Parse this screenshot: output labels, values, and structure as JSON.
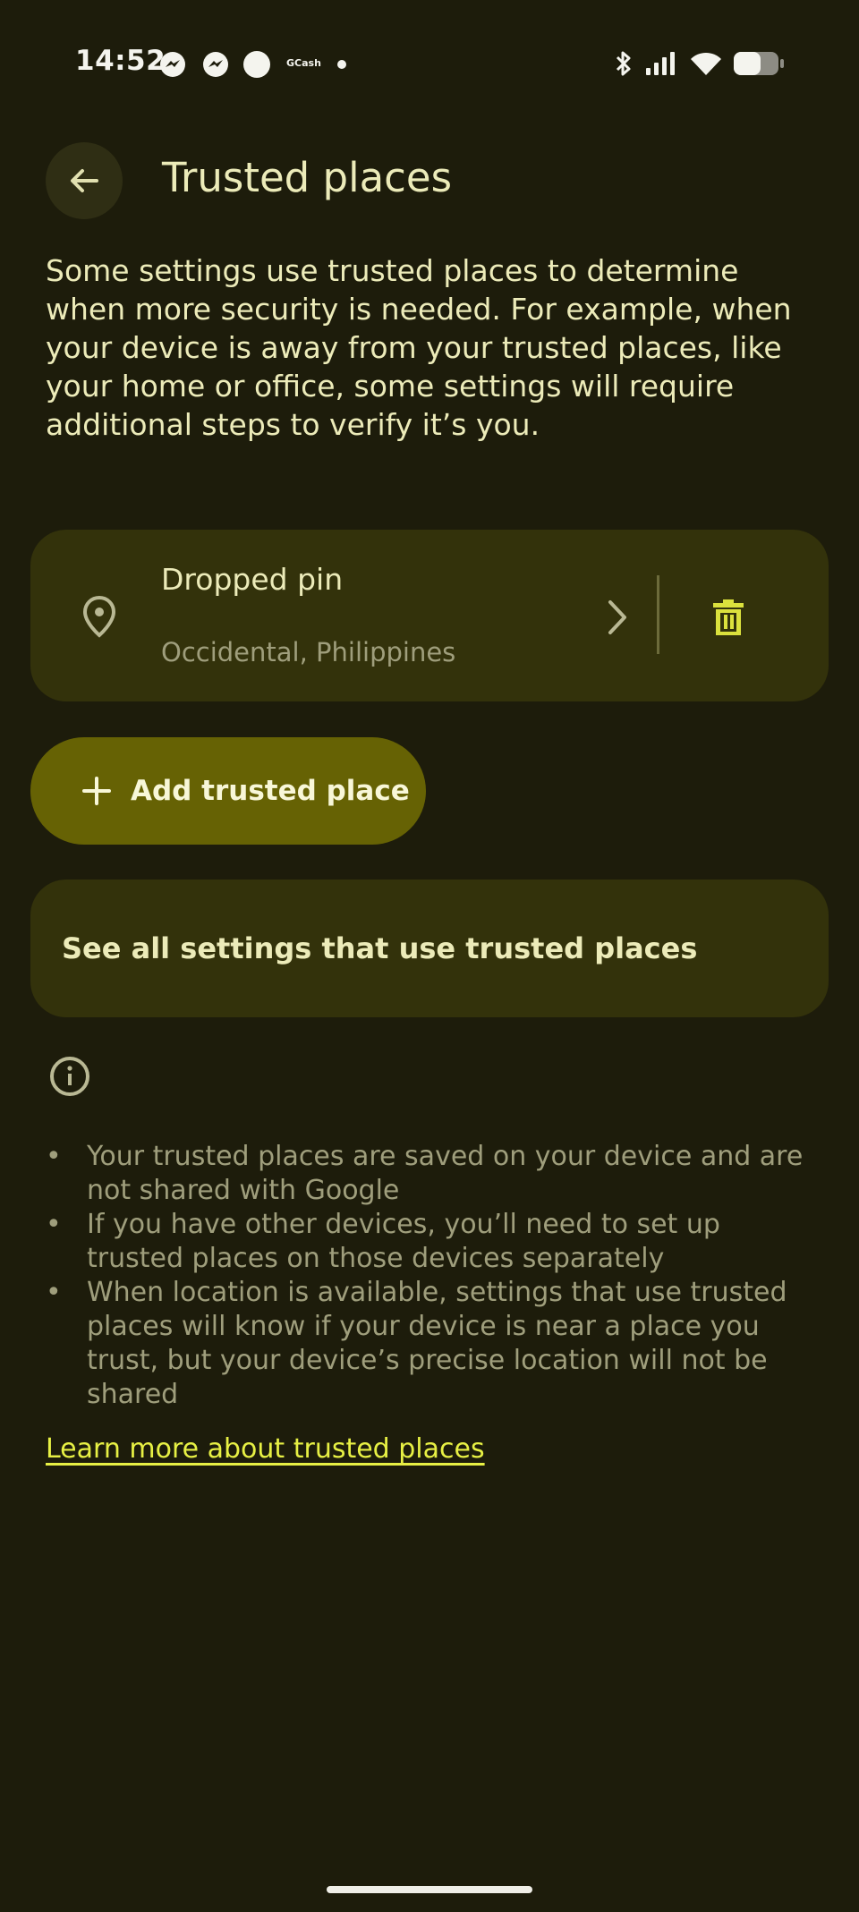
{
  "status_bar": {
    "time": "14:52",
    "notification_icons": [
      "messenger-icon",
      "messenger-icon",
      "circle-icon",
      "gcash-icon",
      "dot-icon"
    ],
    "gcash_label": "GCash",
    "system_icons": [
      "bluetooth-icon",
      "signal-icon",
      "wifi-icon",
      "battery-icon"
    ]
  },
  "header": {
    "back_icon": "arrow-back-icon",
    "title": "Trusted places"
  },
  "description": "Some settings use trusted places to determine when more security is needed. For example, when your device is away from your trusted places, like your home or office, some settings will require additional steps to verify it’s you.",
  "place": {
    "icon": "location-pin-icon",
    "name": "Dropped pin",
    "address_line1": "",
    "address_line2": "Occidental, Philippines",
    "chevron_icon": "chevron-right-icon",
    "delete_icon": "trash-icon"
  },
  "add_button": {
    "icon": "plus-icon",
    "label": "Add trusted place"
  },
  "see_all": {
    "label": "See all settings that use trusted places"
  },
  "info": {
    "icon": "info-icon",
    "bullet": "•",
    "items": [
      "Your trusted places are saved on your device and are not shared with Google",
      "If you have other devices, you’ll need to set up trusted places on those devices separately",
      "When location is available, settings that use trusted places will know if your device is near a place you trust, but your device’s precise location will not be shared"
    ]
  },
  "learn_more": "Learn more about trusted places",
  "colors": {
    "background": "#1d1c0b",
    "card": "#33320b",
    "accent_button": "#666204",
    "link": "#e7f044",
    "text_primary": "#ecebb9",
    "text_secondary": "#9f9e7c"
  }
}
